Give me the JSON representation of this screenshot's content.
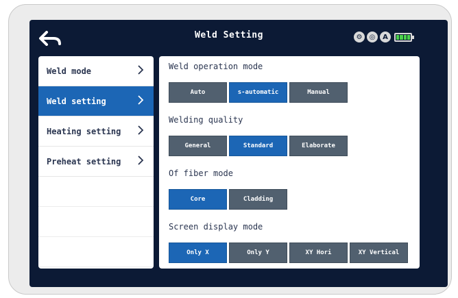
{
  "header": {
    "title": "Weld Setting",
    "status": [
      "⚙",
      "◎",
      "A"
    ]
  },
  "sidebar": {
    "items": [
      {
        "label": "Weld mode",
        "active": false
      },
      {
        "label": "Weld setting",
        "active": true
      },
      {
        "label": "Heating setting",
        "active": false
      },
      {
        "label": "Preheat setting",
        "active": false
      }
    ]
  },
  "panel": {
    "sections": [
      {
        "label": "Weld operation mode",
        "options": [
          "Auto",
          "s-automatic",
          "Manual"
        ],
        "selected": 1
      },
      {
        "label": "Welding quality",
        "options": [
          "General",
          "Standard",
          "Elaborate"
        ],
        "selected": 1
      },
      {
        "label": "Of fiber mode",
        "options": [
          "Core",
          "Cladding"
        ],
        "selected": 0
      },
      {
        "label": "Screen display mode",
        "options": [
          "Only X",
          "Only Y",
          "XY Hori",
          "XY Vertical"
        ],
        "selected": 0
      }
    ]
  },
  "colors": {
    "screen_bg": "#0c1a35",
    "accent": "#1c66b5",
    "button_default": "#51606f",
    "battery": "#4cd24c"
  }
}
